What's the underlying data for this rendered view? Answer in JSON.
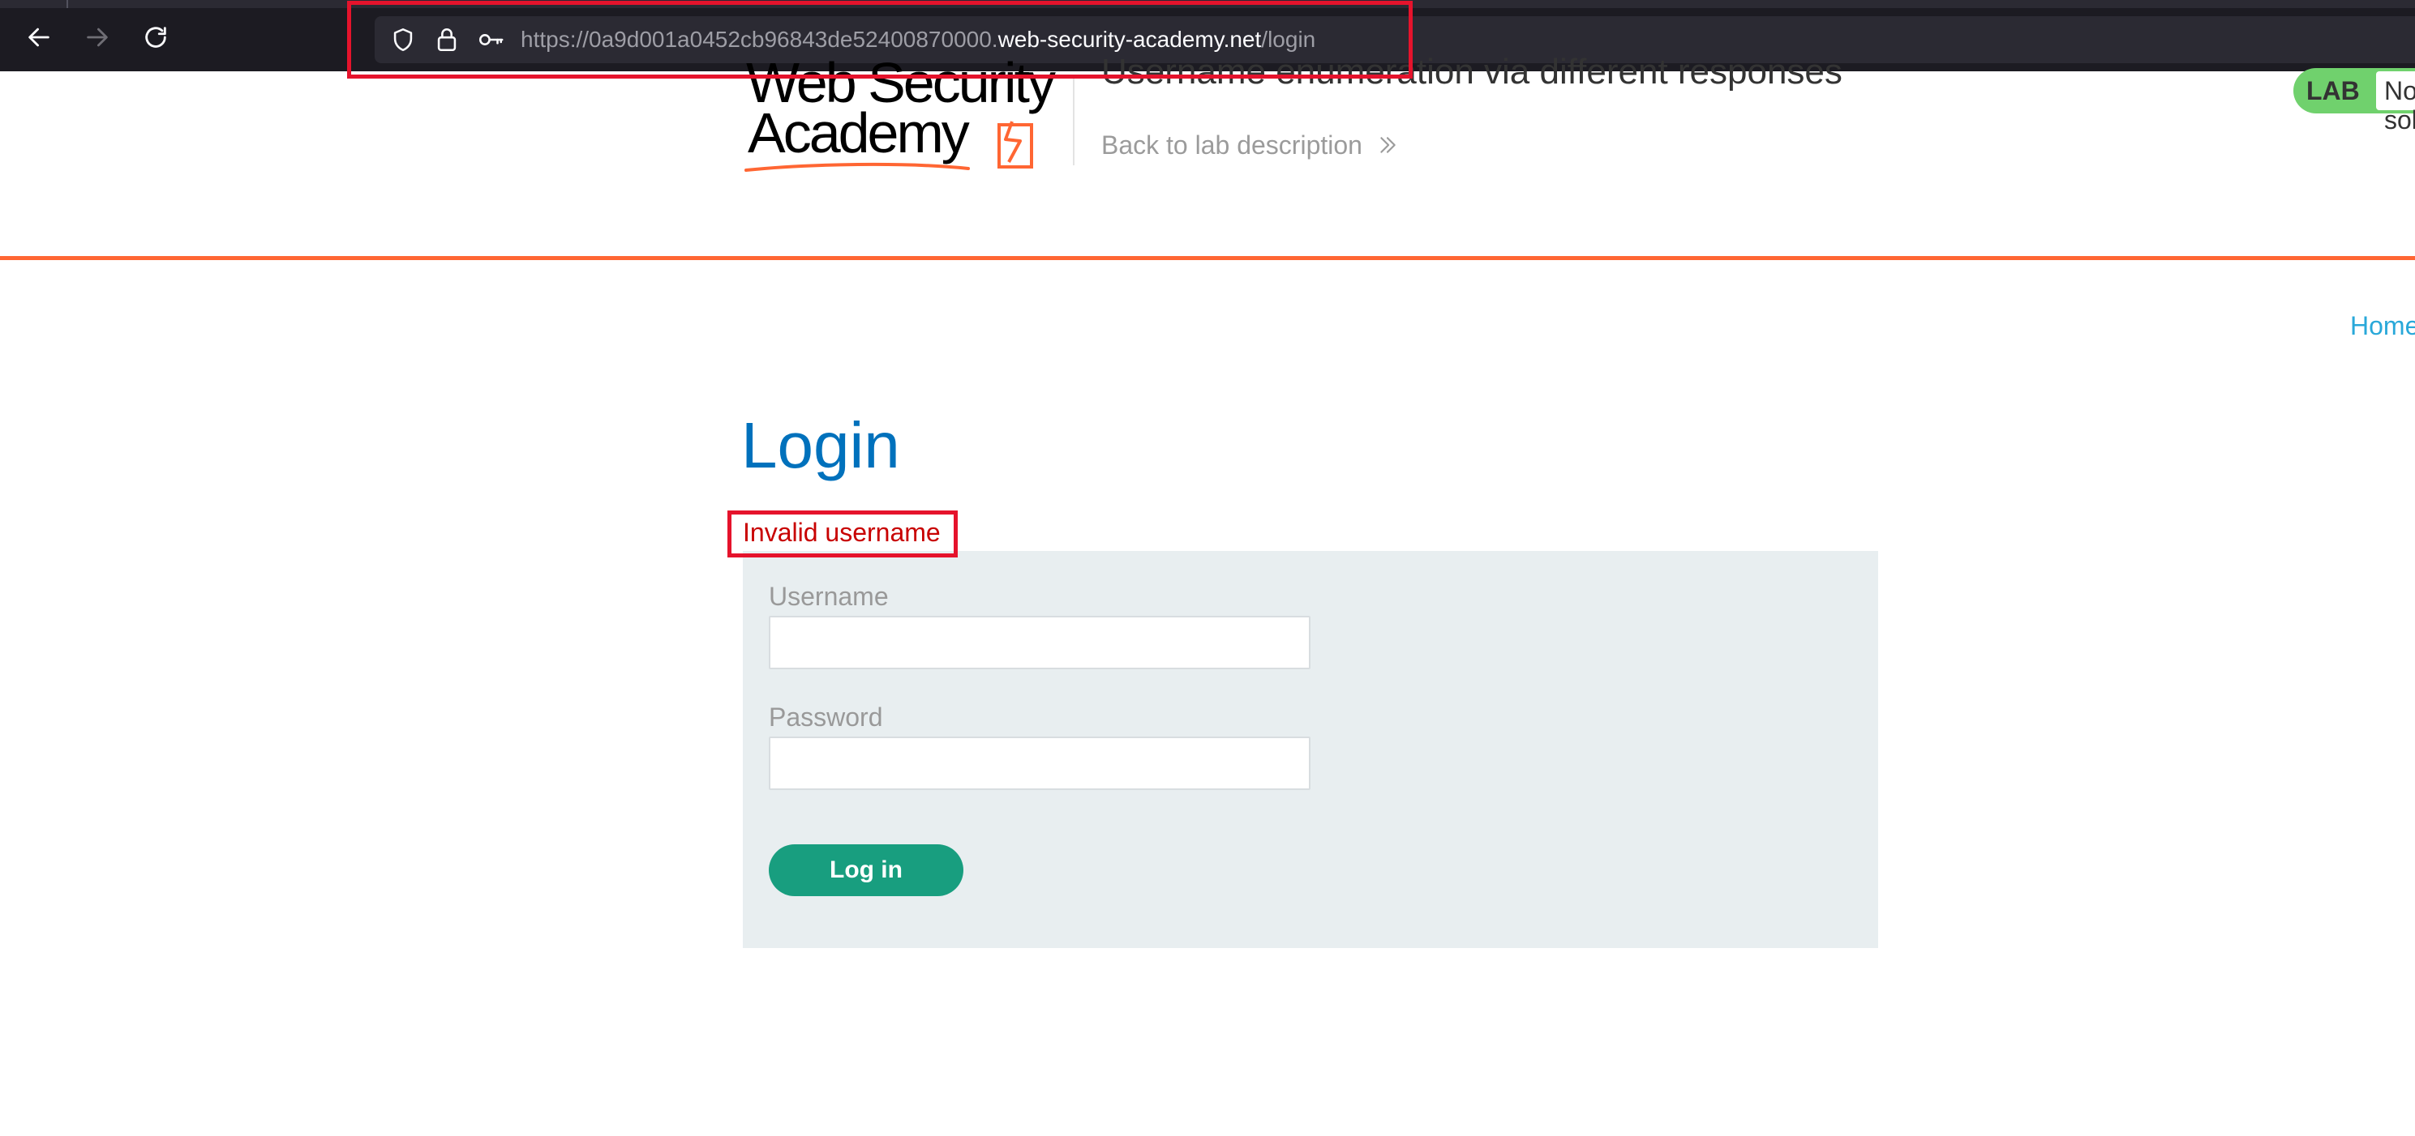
{
  "browser": {
    "url_prefix": "https://0a9d001a0452cb96843de52400870000.",
    "url_host": "web-security-academy.net",
    "url_path": "/login",
    "annotation_color": "#e5132c"
  },
  "lab_header": {
    "logo_line1": "Web Security",
    "logo_line2": "Academy",
    "title": "Username enumeration via different responses",
    "back_link": "Back to lab description",
    "status_label": "LAB",
    "status_value": "Not solved",
    "accent_color": "#ff6633"
  },
  "nav": {
    "home": "Home"
  },
  "login": {
    "heading": "Login",
    "error": "Invalid username",
    "username_label": "Username",
    "username_value": "",
    "password_label": "Password",
    "password_value": "",
    "submit_label": "Log in"
  }
}
